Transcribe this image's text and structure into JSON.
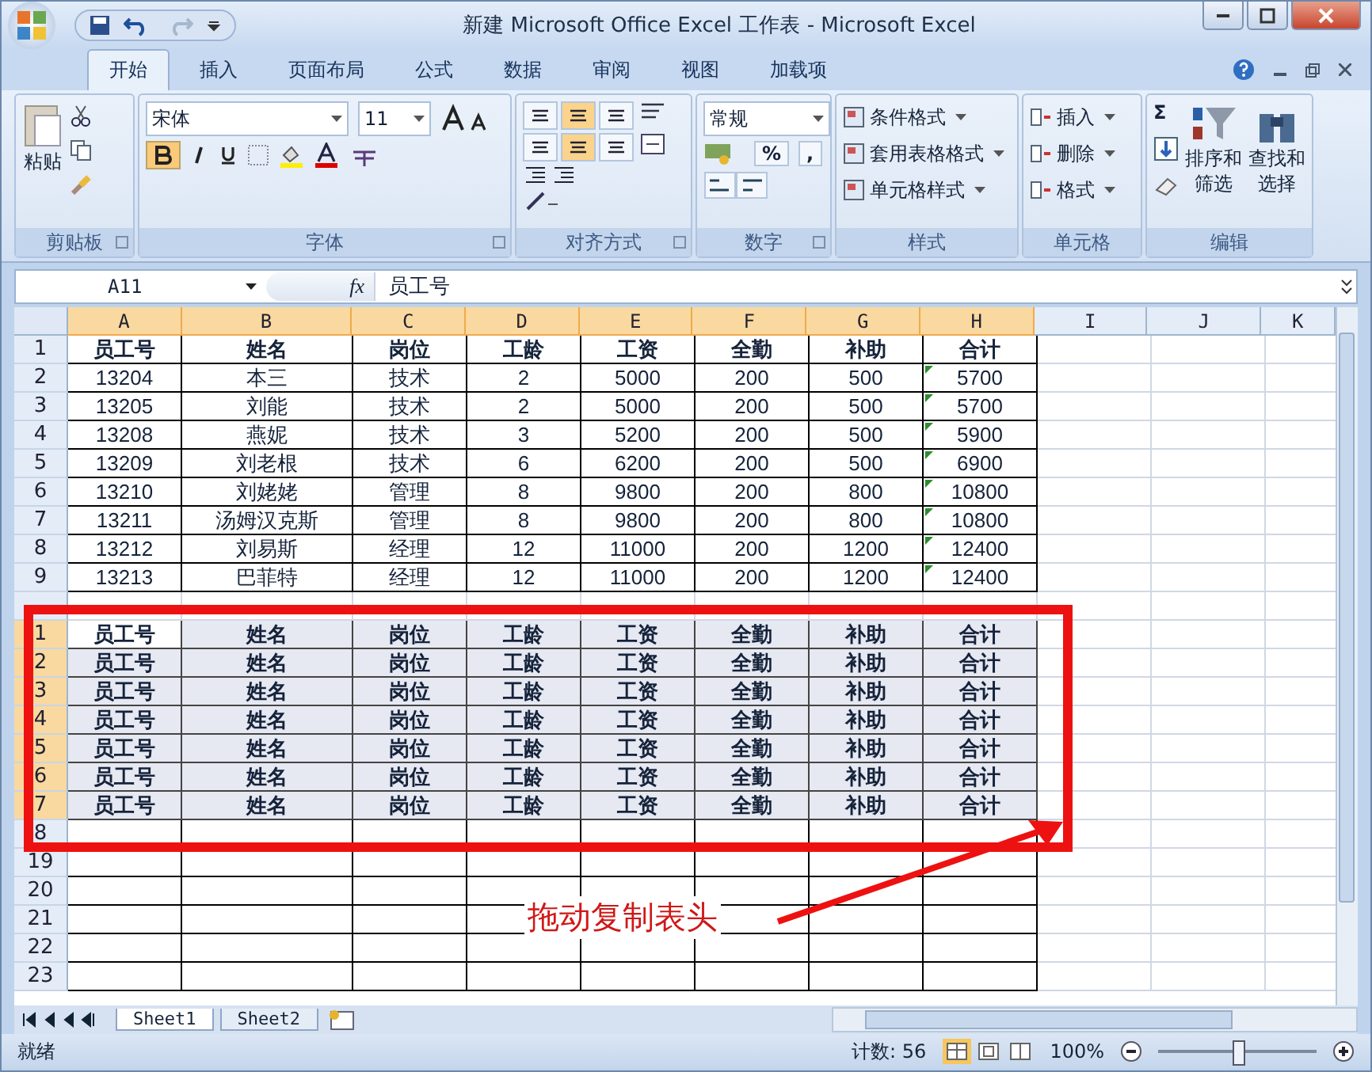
{
  "window": {
    "title": "新建 Microsoft Office Excel 工作表 - Microsoft Excel"
  },
  "tabs": [
    {
      "label": "开始",
      "selected": true
    },
    {
      "label": "插入",
      "selected": false
    },
    {
      "label": "页面布局",
      "selected": false
    },
    {
      "label": "公式",
      "selected": false
    },
    {
      "label": "数据",
      "selected": false
    },
    {
      "label": "审阅",
      "selected": false
    },
    {
      "label": "视图",
      "selected": false
    },
    {
      "label": "加载项",
      "selected": false
    }
  ],
  "ribbon": {
    "clipboard": {
      "paste": "粘贴",
      "label": "剪贴板"
    },
    "font": {
      "name": "宋体",
      "size": "11",
      "bold": true,
      "label": "字体"
    },
    "alignment": {
      "buttons": [
        {
          "selected": false
        },
        {
          "selected": true
        },
        {
          "selected": false
        },
        {
          "selected": false
        },
        {
          "selected": true
        },
        {
          "selected": false
        }
      ],
      "label": "对齐方式"
    },
    "number": {
      "format": "常规",
      "percent": "%",
      "comma": ",",
      "label": "数字"
    },
    "styles": {
      "items": [
        "条件格式",
        "套用表格格式",
        "单元格样式"
      ],
      "label": "样式"
    },
    "cells": {
      "items": [
        "插入",
        "删除",
        "格式"
      ],
      "label": "单元格"
    },
    "editing": {
      "sigma": "Σ",
      "sort": [
        "排序和",
        "筛选"
      ],
      "find": [
        "查找和",
        "选择"
      ],
      "label": "编辑"
    }
  },
  "formula_bar": {
    "name_box": "A11",
    "fx": "fx",
    "content": "员工号"
  },
  "columns": [
    {
      "label": "A",
      "selected": true
    },
    {
      "label": "B",
      "selected": true
    },
    {
      "label": "C",
      "selected": true
    },
    {
      "label": "D",
      "selected": true
    },
    {
      "label": "E",
      "selected": true
    },
    {
      "label": "F",
      "selected": true
    },
    {
      "label": "G",
      "selected": true
    },
    {
      "label": "H",
      "selected": true
    },
    {
      "label": "I",
      "selected": false
    },
    {
      "label": "J",
      "selected": false
    },
    {
      "label": "K",
      "selected": false
    }
  ],
  "rows": [
    {
      "kind": "header",
      "header": "1",
      "cells": [
        "员工号",
        "姓名",
        "岗位",
        "工龄",
        "工资",
        "全勤",
        "补助",
        "合计"
      ]
    },
    {
      "kind": "data",
      "header": "2",
      "flagged": true,
      "cells": [
        "13204",
        "本三",
        "技术",
        "2",
        "5000",
        "200",
        "500",
        "5700"
      ]
    },
    {
      "kind": "data",
      "header": "3",
      "flagged": true,
      "cells": [
        "13205",
        "刘能",
        "技术",
        "2",
        "5000",
        "200",
        "500",
        "5700"
      ]
    },
    {
      "kind": "data",
      "header": "4",
      "flagged": true,
      "cells": [
        "13208",
        "燕妮",
        "技术",
        "3",
        "5200",
        "200",
        "500",
        "5900"
      ]
    },
    {
      "kind": "data",
      "header": "5",
      "flagged": true,
      "cells": [
        "13209",
        "刘老根",
        "技术",
        "6",
        "6200",
        "200",
        "500",
        "6900"
      ]
    },
    {
      "kind": "data",
      "header": "6",
      "flagged": true,
      "cells": [
        "13210",
        "刘姥姥",
        "管理",
        "8",
        "9800",
        "200",
        "800",
        "10800"
      ]
    },
    {
      "kind": "data",
      "header": "7",
      "flagged": true,
      "cells": [
        "13211",
        "汤姆汉克斯",
        "管理",
        "8",
        "9800",
        "200",
        "800",
        "10800"
      ]
    },
    {
      "kind": "data",
      "header": "8",
      "flagged": true,
      "cells": [
        "13212",
        "刘易斯",
        "经理",
        "12",
        "11000",
        "200",
        "1200",
        "12400"
      ]
    },
    {
      "kind": "data",
      "header": "9",
      "flagged": true,
      "cells": [
        "13213",
        "巴菲特",
        "经理",
        "12",
        "11000",
        "200",
        "1200",
        "12400"
      ]
    },
    {
      "kind": "covered"
    },
    {
      "kind": "copy",
      "header": "1",
      "active": true,
      "cells": [
        "员工号",
        "姓名",
        "岗位",
        "工龄",
        "工资",
        "全勤",
        "补助",
        "合计"
      ]
    },
    {
      "kind": "copy",
      "header": "2",
      "active": false,
      "cells": [
        "员工号",
        "姓名",
        "岗位",
        "工龄",
        "工资",
        "全勤",
        "补助",
        "合计"
      ]
    },
    {
      "kind": "copy",
      "header": "3",
      "active": false,
      "cells": [
        "员工号",
        "姓名",
        "岗位",
        "工龄",
        "工资",
        "全勤",
        "补助",
        "合计"
      ]
    },
    {
      "kind": "copy",
      "header": "4",
      "active": false,
      "cells": [
        "员工号",
        "姓名",
        "岗位",
        "工龄",
        "工资",
        "全勤",
        "补助",
        "合计"
      ]
    },
    {
      "kind": "copy",
      "header": "5",
      "active": false,
      "cells": [
        "员工号",
        "姓名",
        "岗位",
        "工龄",
        "工资",
        "全勤",
        "补助",
        "合计"
      ]
    },
    {
      "kind": "copy",
      "header": "6",
      "active": false,
      "cells": [
        "员工号",
        "姓名",
        "岗位",
        "工龄",
        "工资",
        "全勤",
        "补助",
        "合计"
      ]
    },
    {
      "kind": "copy",
      "header": "7",
      "active": false,
      "cells": [
        "员工号",
        "姓名",
        "岗位",
        "工龄",
        "工资",
        "全勤",
        "补助",
        "合计"
      ]
    },
    {
      "kind": "empty",
      "header": "8"
    },
    {
      "kind": "empty",
      "header": "19"
    },
    {
      "kind": "empty",
      "header": "20"
    },
    {
      "kind": "empty",
      "header": "21"
    },
    {
      "kind": "empty",
      "header": "22"
    },
    {
      "kind": "empty",
      "header": "23"
    }
  ],
  "annotation": {
    "text": "拖动复制表头"
  },
  "sheet_tabs": [
    {
      "label": "Sheet1",
      "selected": true
    },
    {
      "label": "Sheet2",
      "selected": false
    }
  ],
  "status_bar": {
    "ready": "就绪",
    "count": "计数: 56",
    "zoom": "100%",
    "zoom_slider": {
      "level": 0.5
    }
  }
}
